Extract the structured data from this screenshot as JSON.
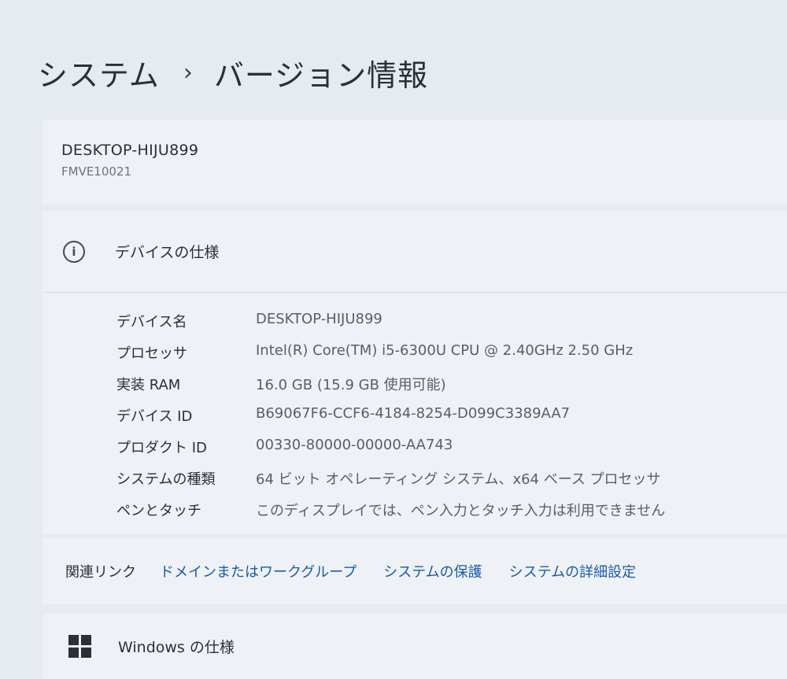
{
  "breadcrumb": {
    "parent": "システム",
    "separator": "›",
    "current": "バージョン情報"
  },
  "device": {
    "name": "DESKTOP-HIJU899",
    "model": "FMVE10021"
  },
  "device_specs": {
    "icon": "info-icon",
    "title": "デバイスの仕様",
    "rows": [
      {
        "label": "デバイス名",
        "value": "DESKTOP-HIJU899"
      },
      {
        "label": "プロセッサ",
        "value": "Intel(R) Core(TM) i5-6300U CPU @ 2.40GHz   2.50 GHz"
      },
      {
        "label": "実装 RAM",
        "value": "16.0 GB (15.9 GB 使用可能)"
      },
      {
        "label": "デバイス ID",
        "value": "B69067F6-CCF6-4184-8254-D099C3389AA7"
      },
      {
        "label": "プロダクト ID",
        "value": "00330-80000-00000-AA743"
      },
      {
        "label": "システムの種類",
        "value": "64 ビット オペレーティング システム、x64 ベース プロセッサ"
      },
      {
        "label": "ペンとタッチ",
        "value": "このディスプレイでは、ペン入力とタッチ入力は利用できません"
      }
    ]
  },
  "related_links": {
    "heading": "関連リンク",
    "links": [
      "ドメインまたはワークグループ",
      "システムの保護",
      "システムの詳細設定"
    ]
  },
  "windows_specs": {
    "icon": "windows-logo-icon",
    "title": "Windows の仕様"
  },
  "colors": {
    "background": "#e6ebf1",
    "card": "#eef2f6",
    "link": "#1a5aa8"
  }
}
